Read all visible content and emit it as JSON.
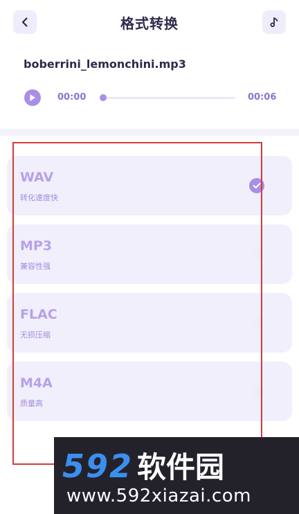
{
  "header": {
    "title": "格式转换",
    "back_icon": "chevron-left-icon",
    "music_icon": "music-note-icon"
  },
  "audio": {
    "filename": "boberrini_lemonchini.mp3",
    "current_time": "00:00",
    "duration": "00:06",
    "progress": 0.0,
    "play_icon": "play-icon"
  },
  "formats": [
    {
      "name": "WAV",
      "desc": "转化速度快",
      "selected": true
    },
    {
      "name": "MP3",
      "desc": "兼容性强",
      "selected": false
    },
    {
      "name": "FLAC",
      "desc": "无损压缩",
      "selected": false
    },
    {
      "name": "M4A",
      "desc": "质量高",
      "selected": false
    }
  ],
  "watermark": {
    "brand_number": "592",
    "brand_text": "软件园",
    "url": "www.592xiazai.com"
  },
  "colors": {
    "accent": "#a98ee6",
    "card_bg": "#f1effb",
    "annotation_border": "#d43a3a",
    "watermark_blue": "#3a8ff0"
  }
}
